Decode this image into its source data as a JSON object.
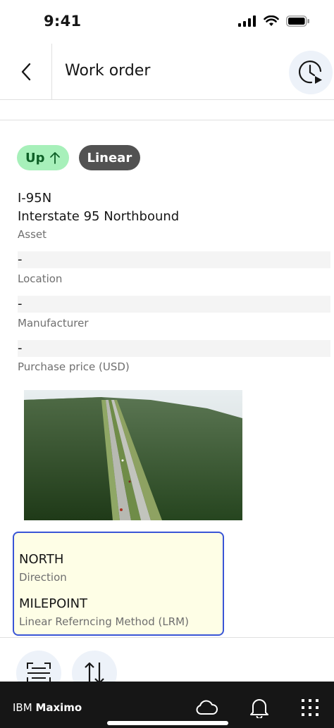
{
  "status_bar": {
    "time": "9:41"
  },
  "header": {
    "title": "Work order"
  },
  "tags": {
    "up_label": "Up",
    "linear_label": "Linear"
  },
  "asset": {
    "id": "I-95N",
    "description": "Interstate 95 Northbound",
    "label": "Asset"
  },
  "fields": [
    {
      "value": "-",
      "label": "Location"
    },
    {
      "value": "-",
      "label": "Manufacturer"
    },
    {
      "value": "-",
      "label": "Purchase price (USD)"
    }
  ],
  "lrm": {
    "direction_value": "NORTH",
    "direction_label": "Direction",
    "method_value": "MILEPOINT",
    "method_label": "Linear Referncing Method (LRM)"
  },
  "bottom_bar": {
    "brand_prefix": "IBM",
    "brand_name": "Maximo"
  },
  "colors": {
    "up_tag_bg": "#a7f0ba",
    "up_tag_text": "#0e6027",
    "linear_tag_bg": "#525252",
    "card_border": "#3955d6",
    "card_bg": "#fefee6",
    "bottom_bar_bg": "#161616"
  }
}
